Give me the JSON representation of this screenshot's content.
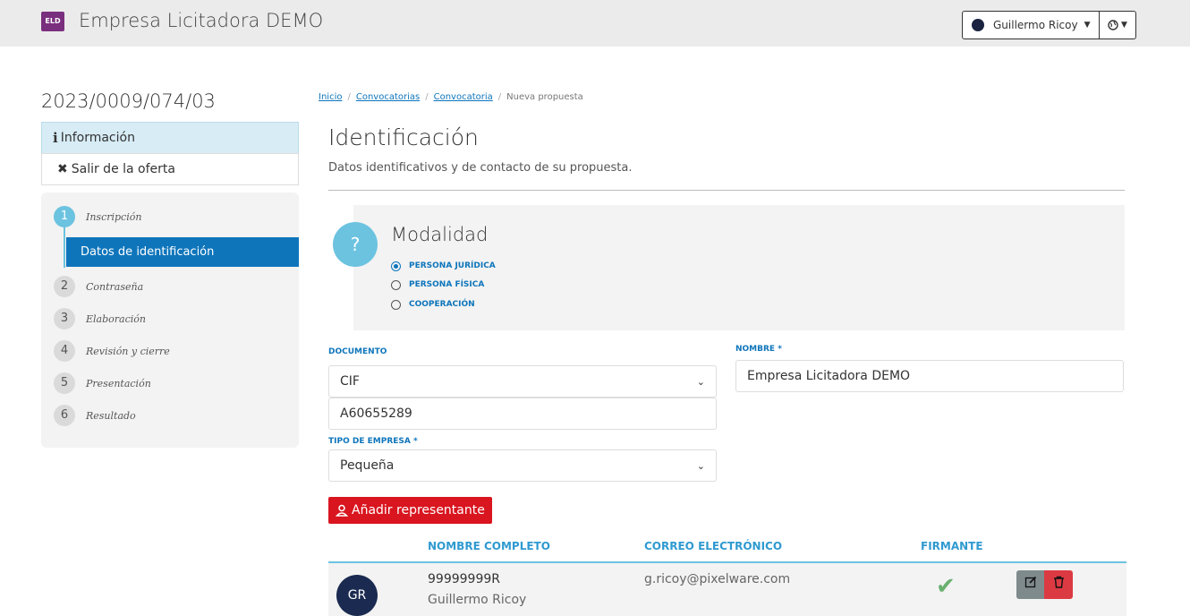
{
  "header": {
    "logo": "ELD",
    "title": "Empresa Licitadora DEMO",
    "user": "Guillermo Ricoy",
    "lang_icon": "globe-icon"
  },
  "sidebar": {
    "offer_id": "2023/0009/074/03",
    "info_label": "Información",
    "exit_label": "Salir de la oferta",
    "steps": [
      {
        "num": "1",
        "label": "Inscripción"
      },
      {
        "num": "2",
        "label": "Contraseña"
      },
      {
        "num": "3",
        "label": "Elaboración"
      },
      {
        "num": "4",
        "label": "Revisión y cierre"
      },
      {
        "num": "5",
        "label": "Presentación"
      },
      {
        "num": "6",
        "label": "Resultado"
      }
    ],
    "active_sub": "Datos de identificación"
  },
  "breadcrumb": [
    "Inicio",
    "Convocatorias",
    "Convocatoria",
    "Nueva propuesta"
  ],
  "page": {
    "title": "Identificación",
    "subtitle": "Datos identificativos y de contacto de su propuesta."
  },
  "modalidad": {
    "title": "Modalidad",
    "icon": "?",
    "options": [
      "PERSONA JURÍDICA",
      "PERSONA FÍSICA",
      "COOPERACIÓN"
    ],
    "selected": "PERSONA JURÍDICA"
  },
  "form": {
    "documento_label": "DOCUMENTO",
    "documento_type": "CIF",
    "documento_value": "A60655289",
    "nombre_label": "NOMBRE *",
    "nombre_value": "Empresa Licitadora DEMO",
    "tipo_label": "TIPO DE EMPRESA *",
    "tipo_value": "Pequeña"
  },
  "add_representante": "Añadir representante",
  "table": {
    "headers": [
      "NOMBRE COMPLETO",
      "CORREO ELECTRÓNICO",
      "FIRMANTE"
    ],
    "rows": [
      {
        "initials": "GR",
        "doc": "99999999R",
        "name": "Guillermo Ricoy",
        "email": "g.ricoy@pixelware.com",
        "firmante": "✔"
      }
    ]
  },
  "colors": {
    "accent": "#0e75bb",
    "danger": "#d9151f",
    "light_blue": "#6cc3e0"
  }
}
